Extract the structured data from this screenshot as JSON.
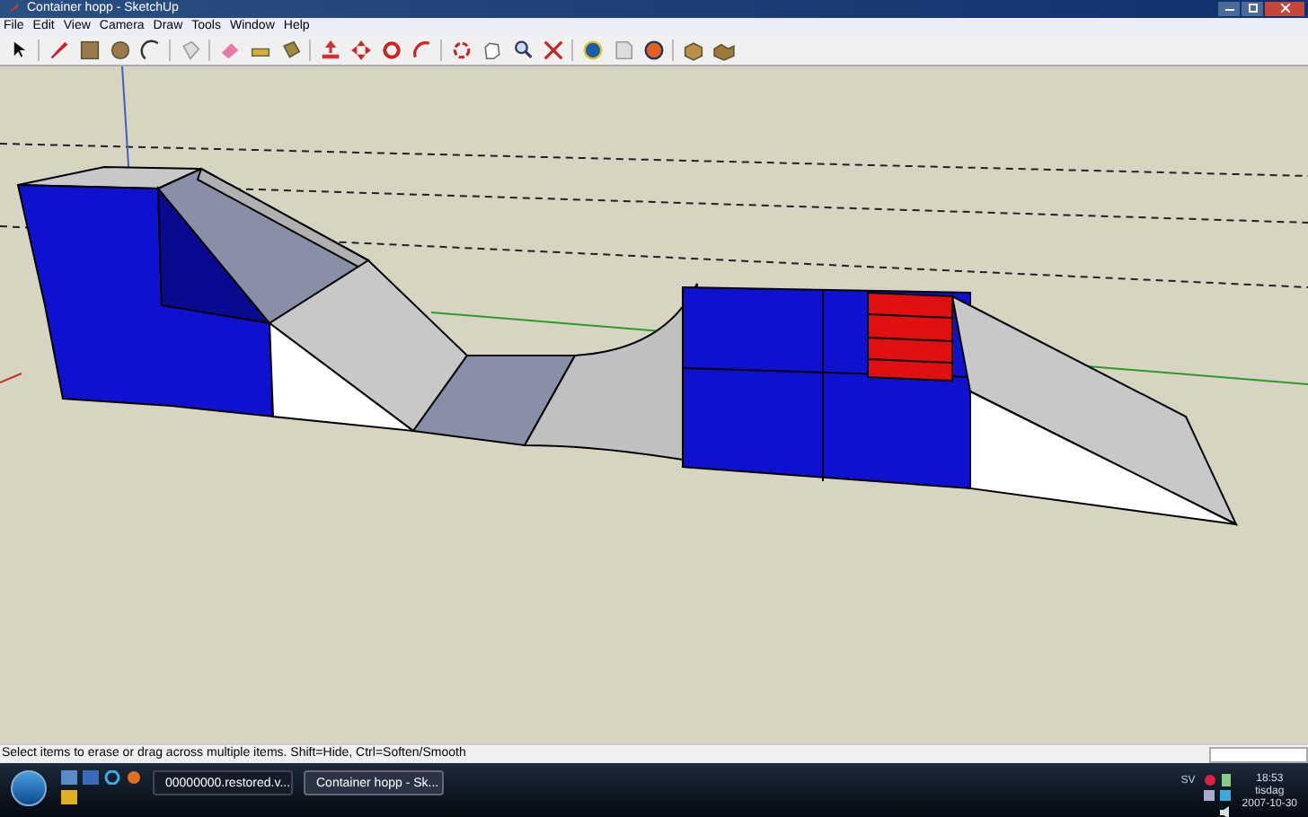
{
  "window": {
    "title": "Container hopp - SketchUp"
  },
  "menu": [
    "File",
    "Edit",
    "View",
    "Camera",
    "Draw",
    "Tools",
    "Window",
    "Help"
  ],
  "status_bar": {
    "text": "Select items to erase or drag across multiple items. Shift=Hide, Ctrl=Soften/Smooth"
  },
  "taskbar": {
    "buttons": [
      {
        "label": "00000000.restored.v...",
        "selected": false
      },
      {
        "label": "Container hopp - Sk...",
        "selected": true
      }
    ],
    "tray": {
      "language": "SV",
      "time": "18:53",
      "day": "tisdag",
      "date": "2007-10-30"
    }
  }
}
